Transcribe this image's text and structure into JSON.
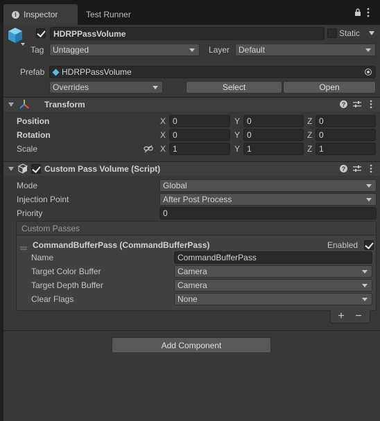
{
  "tabs": [
    {
      "label": "Inspector",
      "icon": "info-icon"
    },
    {
      "label": "Test Runner"
    }
  ],
  "object": {
    "name": "HDRPPassVolume",
    "static_label": "Static",
    "tag_label": "Tag",
    "tag_value": "Untagged",
    "layer_label": "Layer",
    "layer_value": "Default",
    "prefab_label": "Prefab",
    "prefab_value": "HDRPPassVolume",
    "overrides_label": "Overrides",
    "select_label": "Select",
    "open_label": "Open"
  },
  "transform": {
    "title": "Transform",
    "rows": [
      {
        "label": "Position",
        "x": "0",
        "y": "0",
        "z": "0"
      },
      {
        "label": "Rotation",
        "x": "0",
        "y": "0",
        "z": "0"
      },
      {
        "label": "Scale",
        "x": "1",
        "y": "1",
        "z": "1"
      }
    ],
    "axis": {
      "x": "X",
      "y": "Y",
      "z": "Z"
    }
  },
  "custom_pass_volume": {
    "title": "Custom Pass Volume (Script)",
    "mode_label": "Mode",
    "mode_value": "Global",
    "injection_label": "Injection Point",
    "injection_value": "After Post Process",
    "priority_label": "Priority",
    "priority_value": "0",
    "custom_passes_label": "Custom Passes",
    "pass": {
      "title": "CommandBufferPass (CommandBufferPass)",
      "enabled_label": "Enabled",
      "name_label": "Name",
      "name_value": "CommandBufferPass",
      "color_label": "Target Color Buffer",
      "color_value": "Camera",
      "depth_label": "Target Depth Buffer",
      "depth_value": "Camera",
      "clear_label": "Clear Flags",
      "clear_value": "None"
    },
    "plus": "+",
    "minus": "−"
  },
  "add_component_label": "Add Component"
}
